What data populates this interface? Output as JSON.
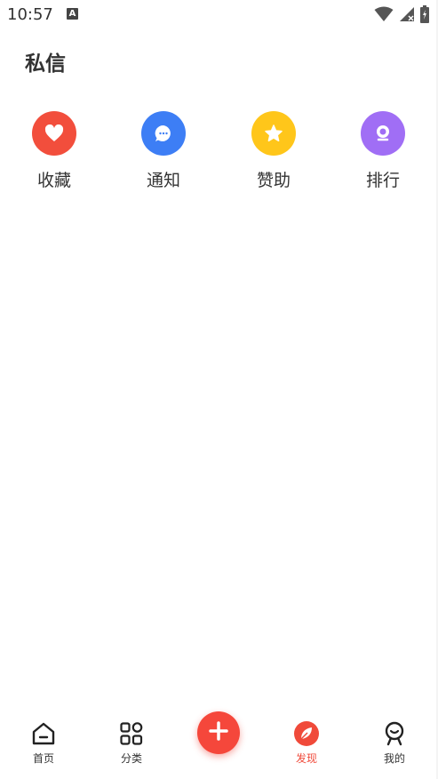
{
  "status_bar": {
    "time": "10:57",
    "notification_icon": "a-letter-icon",
    "icons": [
      "wifi-icon",
      "signal-icon",
      "battery-charging-icon"
    ]
  },
  "header": {
    "title": "私信"
  },
  "quick_actions": [
    {
      "label": "收藏",
      "icon": "heart-icon",
      "color": "#f24e3c"
    },
    {
      "label": "通知",
      "icon": "chat-bubble-icon",
      "color": "#3d7ef5"
    },
    {
      "label": "赞助",
      "icon": "star-icon",
      "color": "#ffc61a"
    },
    {
      "label": "排行",
      "icon": "medal-icon",
      "color": "#a06ef5"
    }
  ],
  "bottom_nav": {
    "items": [
      {
        "label": "首页",
        "icon": "home-icon"
      },
      {
        "label": "分类",
        "icon": "grid-icon"
      },
      {
        "label": "发现",
        "icon": "leaf-icon",
        "active": true
      },
      {
        "label": "我的",
        "icon": "profile-icon"
      }
    ],
    "fab_icon": "plus-icon",
    "active_color": "#f04a3a"
  }
}
